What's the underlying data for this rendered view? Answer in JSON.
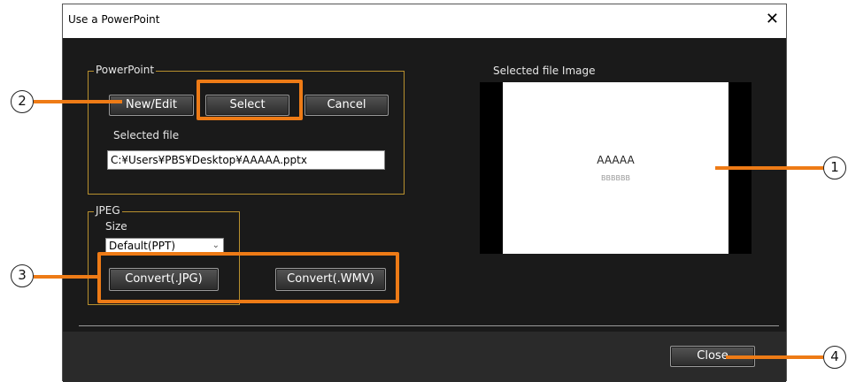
{
  "window": {
    "title": "Use a PowerPoint",
    "close_glyph": "✕"
  },
  "powerpoint": {
    "group_label": "PowerPoint",
    "new_edit": "New/Edit",
    "select": "Select",
    "cancel": "Cancel",
    "selected_file_label": "Selected file",
    "selected_file_value": "C:¥Users¥PBS¥Desktop¥AAAAA.pptx"
  },
  "jpeg": {
    "group_label": "JPEG",
    "size_label": "Size",
    "size_value": "Default(PPT)",
    "convert_jpg": "Convert(.JPG)",
    "convert_wmv": "Convert(.WMV)"
  },
  "preview": {
    "label": "Selected file Image",
    "slide_title": "AAAAA",
    "slide_subtitle": "BBBBBB"
  },
  "footer": {
    "close": "Close"
  },
  "callouts": {
    "one": "1",
    "two": "2",
    "three": "3",
    "four": "4"
  },
  "colors": {
    "highlight": "#ee7b16",
    "group_border": "#b8902e",
    "window_bg": "#1a1a1a"
  }
}
